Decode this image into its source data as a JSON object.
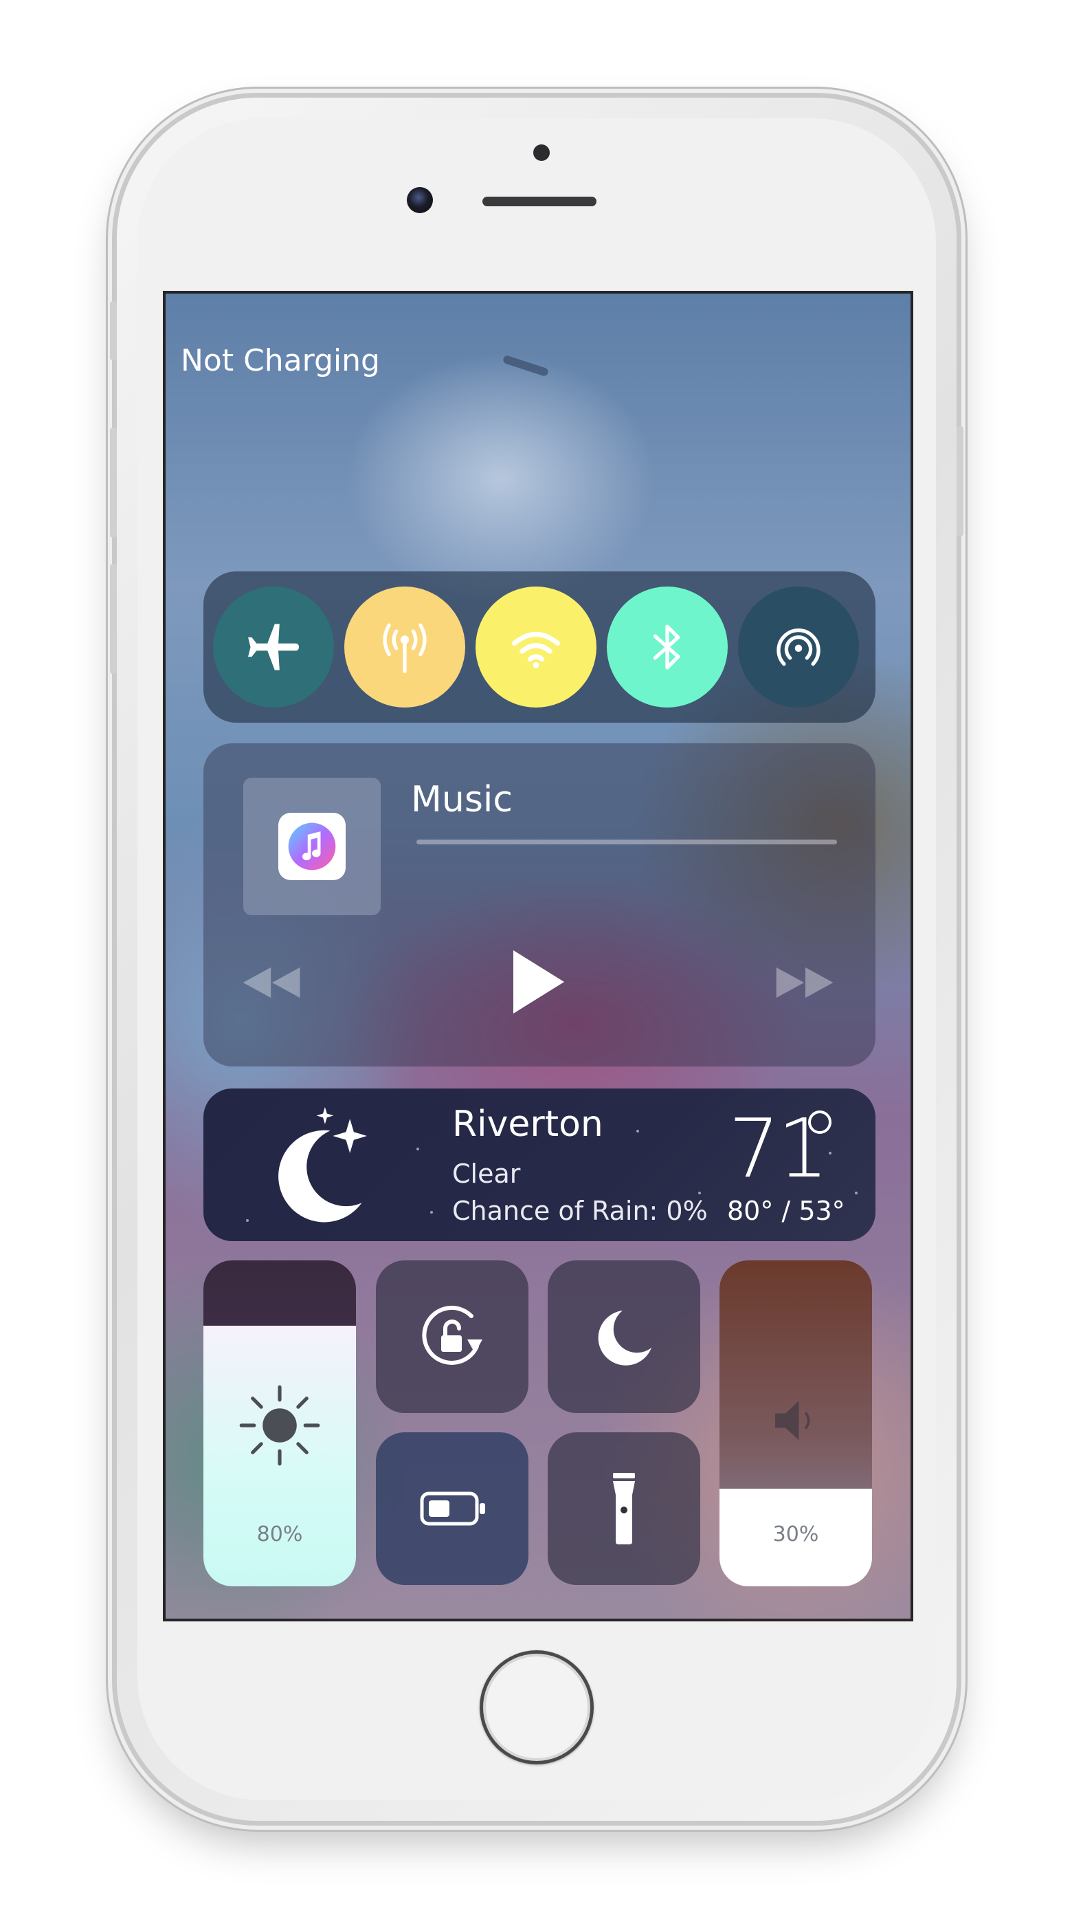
{
  "status": {
    "charging_text": "Not Charging"
  },
  "connectivity": {
    "items": [
      {
        "name": "airplane-mode",
        "icon": "airplane-icon",
        "active": false,
        "color": "#2e6f78"
      },
      {
        "name": "cellular-data",
        "icon": "antenna-icon",
        "active": true,
        "color": "#fbd77b"
      },
      {
        "name": "wifi",
        "icon": "wifi-icon",
        "active": true,
        "color": "#fbf06a"
      },
      {
        "name": "bluetooth",
        "icon": "bluetooth-icon",
        "active": true,
        "color": "#6ff5cc"
      },
      {
        "name": "airdrop",
        "icon": "airdrop-icon",
        "active": false,
        "color": "#2a4e64"
      }
    ]
  },
  "music": {
    "title": "Music",
    "app_icon": "itunes-icon",
    "progress": 0,
    "controls": [
      "rewind-icon",
      "play-icon",
      "fast-forward-icon"
    ]
  },
  "weather": {
    "city": "Riverton",
    "condition": "Clear",
    "rain": "Chance of Rain: 0%",
    "temperature": "71",
    "range": "80° / 53°",
    "icon": "moon-stars-icon"
  },
  "brightness": {
    "level": 0.8,
    "label": "80%",
    "icon": "sun-icon",
    "fill_color": "#d8fbf7"
  },
  "volume": {
    "level": 0.3,
    "label": "30%",
    "icon": "speaker-icon"
  },
  "toggles": [
    {
      "name": "rotation-lock",
      "icon": "rotation-lock-icon"
    },
    {
      "name": "do-not-disturb",
      "icon": "moon-icon"
    },
    {
      "name": "low-power-mode",
      "icon": "battery-icon"
    },
    {
      "name": "flashlight",
      "icon": "flashlight-icon"
    }
  ]
}
